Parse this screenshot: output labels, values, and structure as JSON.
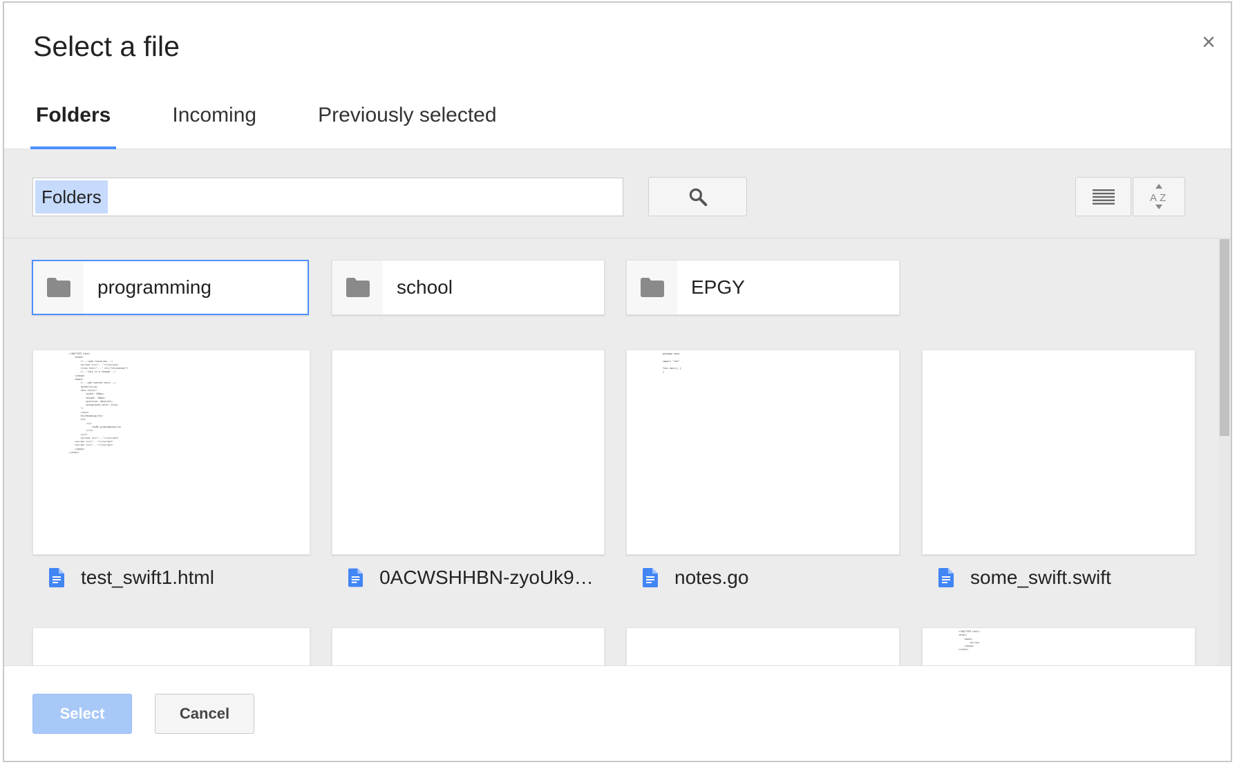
{
  "dialog": {
    "title": "Select a file",
    "close_label": "×"
  },
  "tabs": [
    {
      "label": "Folders",
      "active": true
    },
    {
      "label": "Incoming",
      "active": false
    },
    {
      "label": "Previously selected",
      "active": false
    }
  ],
  "toolbar": {
    "path_chip": "Folders",
    "search_icon": "search-icon",
    "list_view_icon": "list-view-icon",
    "sort_icon": "sort-az-icon"
  },
  "folders": [
    {
      "name": "programming",
      "selected": true
    },
    {
      "name": "school",
      "selected": false
    },
    {
      "name": "EPGY",
      "selected": false
    }
  ],
  "files": [
    {
      "name": "test_swift1.html",
      "icon": "document-icon"
    },
    {
      "name": "0ACWSHHBN-zyoUk9PV...",
      "icon": "document-icon"
    },
    {
      "name": "notes.go",
      "icon": "document-icon"
    },
    {
      "name": "some_swift.swift",
      "icon": "document-icon"
    }
  ],
  "footer": {
    "select_label": "Select",
    "cancel_label": "Cancel"
  },
  "colors": {
    "accent": "#4d90fe",
    "select_disabled": "#a8c8f8",
    "folder_icon": "#8a8a8a",
    "doc_icon": "#4285f4"
  }
}
